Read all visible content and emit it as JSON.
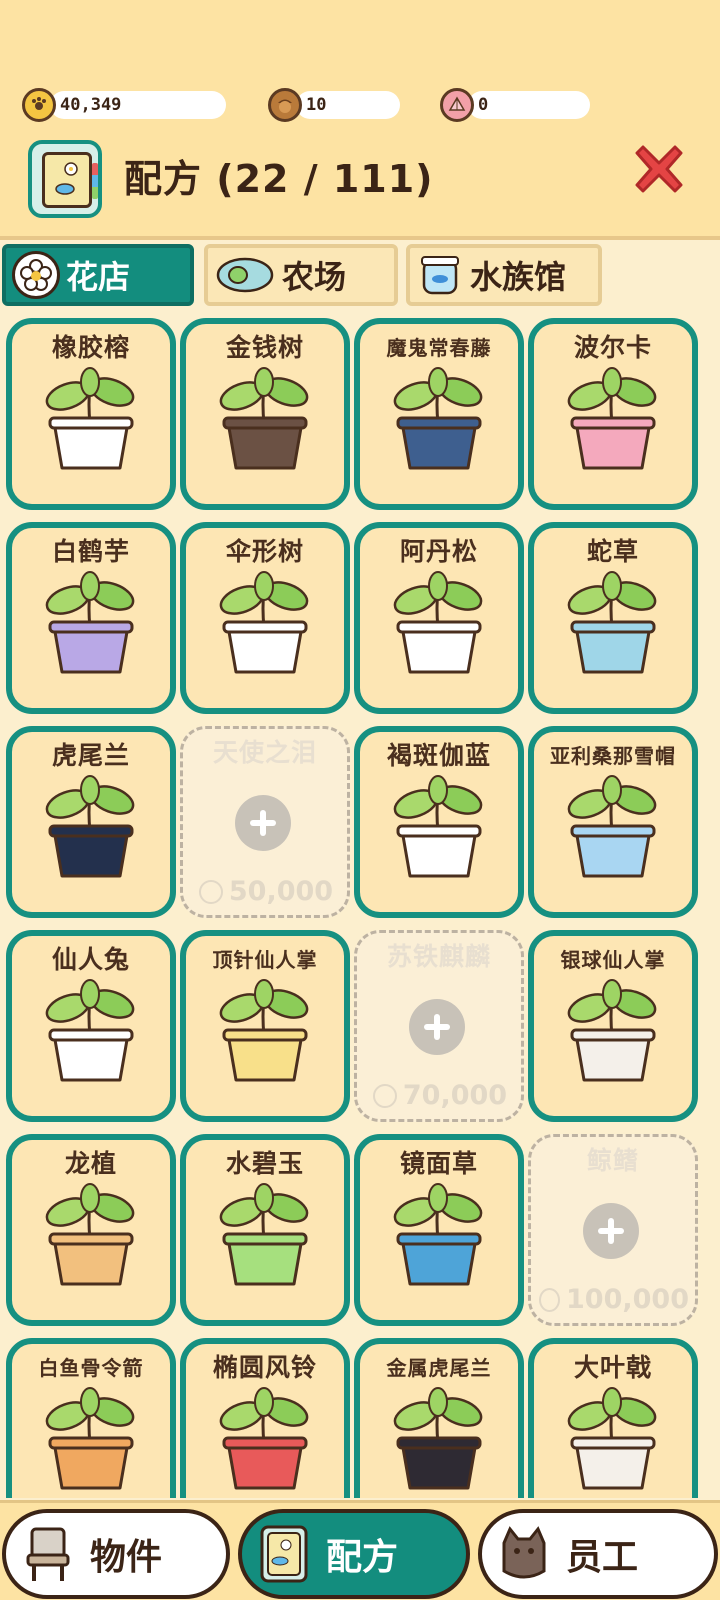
{
  "currencies": [
    {
      "icon": "coin-icon",
      "value": "40,349",
      "color": "#f4c542"
    },
    {
      "icon": "acorn-icon",
      "value": "10",
      "color": "#b97a3a"
    },
    {
      "icon": "shell-icon",
      "value": "0",
      "color": "#f2a0a8"
    }
  ],
  "header": {
    "title": "配方 (22 / 111)"
  },
  "tabs": [
    {
      "label": "花店",
      "icon": "flower-icon",
      "active": true
    },
    {
      "label": "农场",
      "icon": "seed-icon",
      "active": false
    },
    {
      "label": "水族馆",
      "icon": "fishbowl-icon",
      "active": false
    }
  ],
  "recipes": [
    {
      "name": "橡胶榕",
      "locked": false,
      "pot": "#ffffff"
    },
    {
      "name": "金钱树",
      "locked": false,
      "pot": "#6b5144"
    },
    {
      "name": "魔鬼常春藤",
      "locked": false,
      "pot": "#3e5f8f"
    },
    {
      "name": "波尔卡",
      "locked": false,
      "pot": "#f4a9bd"
    },
    {
      "name": "白鹤芋",
      "locked": false,
      "pot": "#b9a8e6"
    },
    {
      "name": "伞形树",
      "locked": false,
      "pot": "#ffffff"
    },
    {
      "name": "阿丹松",
      "locked": false,
      "pot": "#ffffff"
    },
    {
      "name": "蛇草",
      "locked": false,
      "pot": "#9fd6e8"
    },
    {
      "name": "虎尾兰",
      "locked": false,
      "pot": "#23304d"
    },
    {
      "name": "天使之泪",
      "locked": true,
      "price": "50,000"
    },
    {
      "name": "褐斑伽蓝",
      "locked": false,
      "pot": "#ffffff"
    },
    {
      "name": "亚利桑那雪帽",
      "locked": false,
      "pot": "#a9d6f2"
    },
    {
      "name": "仙人兔",
      "locked": false,
      "pot": "#ffffff"
    },
    {
      "name": "顶针仙人掌",
      "locked": false,
      "pot": "#f8e08a"
    },
    {
      "name": "苏铁麒麟",
      "locked": true,
      "price": "70,000"
    },
    {
      "name": "银球仙人掌",
      "locked": false,
      "pot": "#f4f0ea"
    },
    {
      "name": "龙植",
      "locked": false,
      "pot": "#f2c07e"
    },
    {
      "name": "水碧玉",
      "locked": false,
      "pot": "#a6e07e"
    },
    {
      "name": "镜面草",
      "locked": false,
      "pot": "#4ea4d8"
    },
    {
      "name": "鲸鳍",
      "locked": true,
      "price": "100,000"
    },
    {
      "name": "白鱼骨令箭",
      "locked": false,
      "pot": "#f0a860"
    },
    {
      "name": "椭圆风铃",
      "locked": false,
      "pot": "#e85a5a"
    },
    {
      "name": "金属虎尾兰",
      "locked": false,
      "pot": "#2e2a33"
    },
    {
      "name": "大叶戟",
      "locked": false,
      "pot": "#f4f0ea"
    }
  ],
  "bottom_nav": [
    {
      "label": "物件",
      "icon": "chair-icon",
      "active": false
    },
    {
      "label": "配方",
      "icon": "recipe-book-icon",
      "active": true
    },
    {
      "label": "员工",
      "icon": "cat-staff-icon",
      "active": false
    }
  ]
}
